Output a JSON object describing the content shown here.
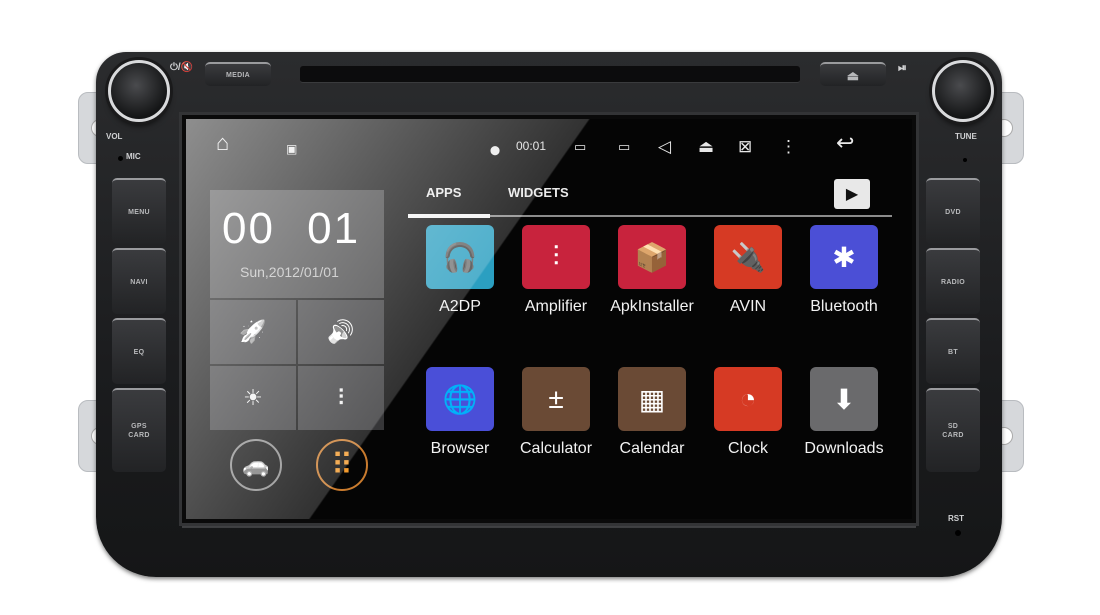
{
  "hardware": {
    "left_buttons": [
      "MENU",
      "NAVI",
      "EQ",
      "GPS CARD"
    ],
    "right_buttons": [
      "DVD",
      "RADIO",
      "BT",
      "SD CARD"
    ],
    "top_left_button": "MEDIA",
    "power_mute_label": "⏻/🔇",
    "vol_label": "VOL",
    "mic_label": "MIC",
    "tune_label": "TUNE",
    "rst_label": "RST",
    "eject_symbol": "⏏",
    "play_pause_symbol": "⏯"
  },
  "status_bar": {
    "home_icon": "⌂",
    "picture_icon": "▣",
    "location_icon": "⬤",
    "time": "00:01",
    "icons": [
      "▭",
      "▭",
      "◁",
      "⏏",
      "⊠",
      "⋮"
    ],
    "back_icon": "↩"
  },
  "clock_widget": {
    "time": "00 01",
    "date": "Sun,2012/01/01"
  },
  "quick_tiles": [
    {
      "name": "rocket",
      "glyph": "🚀"
    },
    {
      "name": "volume",
      "glyph": "🔊"
    },
    {
      "name": "brightness",
      "glyph": "☀"
    },
    {
      "name": "equalizer",
      "glyph": "⫶"
    }
  ],
  "bottom_buttons": {
    "car": "🚗",
    "apps": "⠿"
  },
  "tabs": [
    {
      "label": "APPS",
      "active": true
    },
    {
      "label": "WIDGETS",
      "active": false
    }
  ],
  "store_icon": "▶",
  "apps": [
    {
      "label": "A2DP",
      "color": "#2b9fc1",
      "glyph": "🎧"
    },
    {
      "label": "Amplifier",
      "color": "#c8233d",
      "glyph": "⫶"
    },
    {
      "label": "ApkInstaller",
      "color": "#c8233d",
      "glyph": "📦"
    },
    {
      "label": "AVIN",
      "color": "#d63a24",
      "glyph": "🔌"
    },
    {
      "label": "Bluetooth",
      "color": "#4b4fd6",
      "glyph": "✱"
    },
    {
      "label": "Browser",
      "color": "#4a4fd8",
      "glyph": "🌐"
    },
    {
      "label": "Calculator",
      "color": "#6a4a35",
      "glyph": "±"
    },
    {
      "label": "Calendar",
      "color": "#6a4a35",
      "glyph": "▦"
    },
    {
      "label": "Clock",
      "color": "#d63a24",
      "glyph": "◔"
    },
    {
      "label": "Downloads",
      "color": "#6a6a6c",
      "glyph": "⬇"
    }
  ]
}
